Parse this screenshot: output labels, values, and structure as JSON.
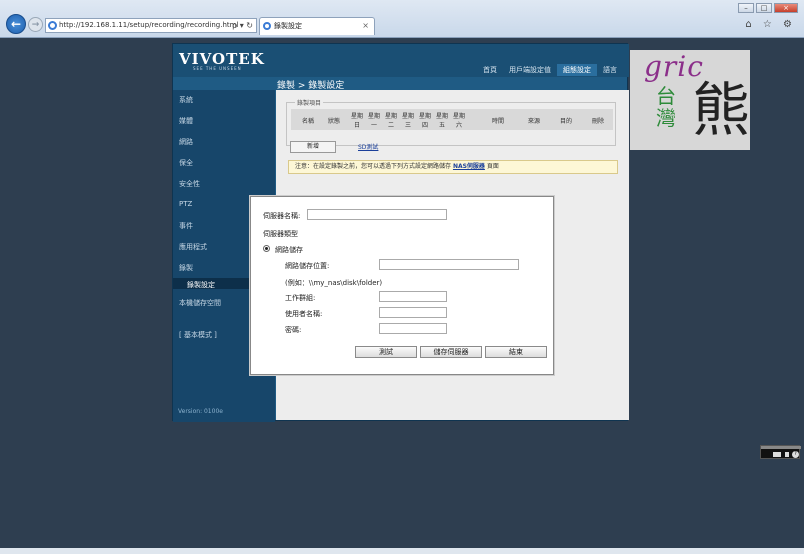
{
  "browser": {
    "url": "http://192.168.1.11/setup/recording/recording.html",
    "url_tools": "ρ ▾ ↻",
    "tab_title": "錄製設定",
    "tab_close": "×",
    "win_min": "–",
    "win_max": "□",
    "win_close": "×",
    "fav_icons": "⌂ ☆ ⚙"
  },
  "camera": {
    "logo": "VIVOTEK",
    "logo_sub": "SEE THE UNSEEN",
    "top_nav": [
      "首頁",
      "用戶端設定值",
      "組態設定",
      "語言"
    ],
    "breadcrumb": "錄製 > 錄製設定",
    "sidebar": [
      "系統",
      "媒體",
      "網路",
      "保全",
      "安全性",
      "PTZ",
      "事件",
      "應用程式",
      "錄製",
      "錄製設定",
      "本機儲存空間",
      "[ 基本模式 ]"
    ],
    "version": "Version: 0100e",
    "recording_fieldset": "錄製項目",
    "table_headers": [
      {
        "top": "名稱",
        "bottom": ""
      },
      {
        "top": "狀態",
        "bottom": ""
      },
      {
        "top": "星期",
        "bottom": "日"
      },
      {
        "top": "星期",
        "bottom": "一"
      },
      {
        "top": "星期",
        "bottom": "二"
      },
      {
        "top": "星期",
        "bottom": "三"
      },
      {
        "top": "星期",
        "bottom": "四"
      },
      {
        "top": "星期",
        "bottom": "五"
      },
      {
        "top": "星期",
        "bottom": "六"
      },
      {
        "top": "時間",
        "bottom": ""
      },
      {
        "top": "來源",
        "bottom": ""
      },
      {
        "top": "目的",
        "bottom": ""
      },
      {
        "top": "刪除",
        "bottom": ""
      }
    ],
    "add_button": "新增",
    "test_link": "SD測試",
    "note_prefix": "注意：在設定錄製之前，您可以透過下列方式設定網路儲存",
    "note_link": "NAS伺服器",
    "note_suffix": "頁面"
  },
  "dialog": {
    "server_name_label": "伺服器名稱:",
    "server_name_value": "",
    "server_type_label": "伺服器類型",
    "network_storage_label": "網路儲存",
    "network_location_label": "網路儲存位置:",
    "network_location_value": "",
    "example_text": "(例如：\\\\my_nas\\disk\\folder)",
    "workgroup_label": "工作群組:",
    "workgroup_value": "",
    "username_label": "使用者名稱:",
    "username_value": "",
    "password_label": "密碼:",
    "password_value": "",
    "test_button": "測試",
    "save_button": "儲存伺服器",
    "close_button": "結束"
  },
  "watermark": {
    "gric": "gric",
    "tai": "台",
    "wan": "灣",
    "xiong": "熊"
  }
}
